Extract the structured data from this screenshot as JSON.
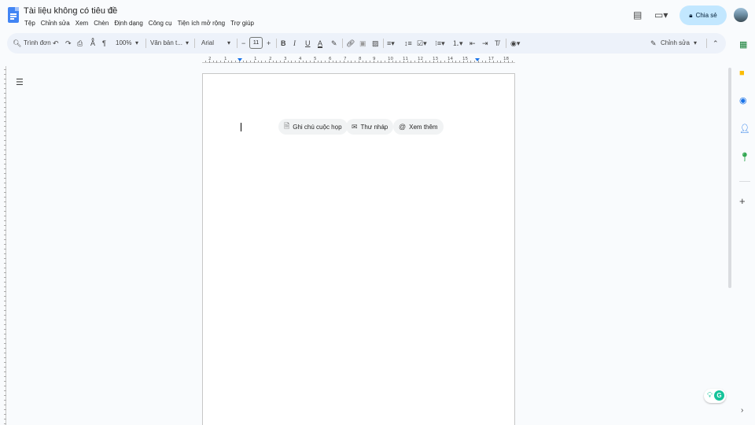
{
  "doc": {
    "title": "Tài liệu không có tiêu đề",
    "star_icon": "star-outline-icon"
  },
  "menu": [
    "Tệp",
    "Chỉnh sửa",
    "Xem",
    "Chèn",
    "Định dạng",
    "Công cụ",
    "Tiện ích mở rộng",
    "Trợ giúp"
  ],
  "header": {
    "share_label": "Chia sẻ",
    "share_icon": "lock-icon"
  },
  "toolbar": {
    "search_label": "Trình đơn",
    "zoom": "100%",
    "style": "Văn bản t...",
    "font": "Arial",
    "font_size": "11",
    "mode_label": "Chỉnh sửa"
  },
  "ruler": {
    "labels": [
      "2",
      "1",
      "1",
      "2",
      "3",
      "4",
      "5",
      "6",
      "7",
      "8",
      "9",
      "10",
      "11",
      "12",
      "13",
      "14",
      "15",
      "16",
      "17",
      "18"
    ]
  },
  "chips": {
    "meeting_notes": "Ghi chú cuộc họp",
    "email_draft": "Thư nháp",
    "more": "Xem thêm"
  },
  "colors": {
    "doc_blue": "#4285f4",
    "share_bg": "#c2e7ff",
    "toolbar_bg": "#edf2fa",
    "app_bg": "#f9fbfd",
    "grammarly": "#15c39a"
  }
}
